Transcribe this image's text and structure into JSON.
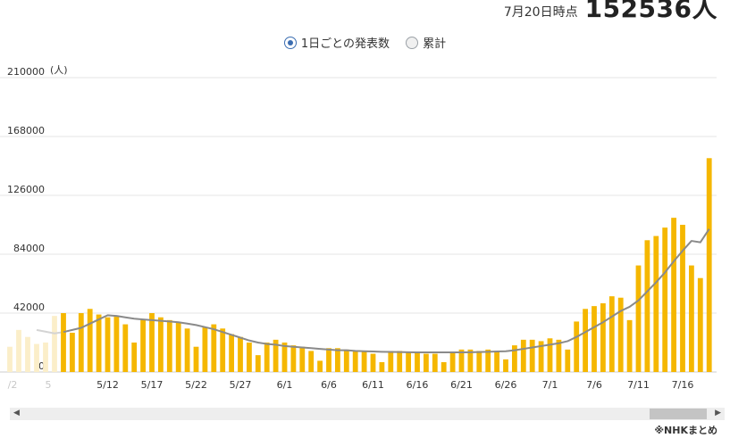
{
  "header": {
    "date_label": "7月20日時点",
    "total_value": "152536人"
  },
  "toggle": {
    "daily_label": "1日ごとの発表数",
    "cumulative_label": "累計",
    "selected": "daily"
  },
  "source": "※NHKまとめ",
  "colors": {
    "bar": "#f5b700",
    "faded_bar": "#fbeec9",
    "avg_line": "#8a8a8a",
    "faded_line": "#d4d4d4",
    "grid": "#e6e6e6"
  },
  "chart_data": {
    "type": "bar",
    "unit_label": "(人)",
    "ylim": [
      0,
      210000
    ],
    "y_ticks": [
      "0",
      "42000",
      "84000",
      "126000",
      "168000",
      "210000"
    ],
    "x_tick_labels": [
      "5/7",
      "5/12",
      "5/17",
      "5/22",
      "5/27",
      "6/1",
      "6/6",
      "6/11",
      "6/16",
      "6/21",
      "6/26",
      "7/1",
      "7/6",
      "7/11",
      "7/16"
    ],
    "start_date": "5/7",
    "faded_prefix": {
      "tick_labels": [
        "/2",
        "5"
      ],
      "values": [
        18000,
        30000,
        25000,
        20000,
        21000,
        40000
      ],
      "avg": [
        30000,
        27500
      ]
    },
    "series": [
      {
        "values": [
          42000,
          28000,
          42000,
          45000,
          41000,
          39000,
          40000,
          34000,
          21000,
          37000,
          42000,
          39000,
          37000,
          35000,
          31000,
          18000,
          32000,
          34000,
          31000,
          27000,
          25000,
          21000,
          12000,
          21000,
          23000,
          21000,
          19000,
          18000,
          15000,
          8000,
          17000,
          17000,
          16000,
          15000,
          15000,
          13000,
          7000,
          15000,
          15000,
          14000,
          14000,
          13000,
          13000,
          7000,
          14000,
          16000,
          16000,
          15000,
          16000,
          15000,
          9000,
          19000,
          23000,
          23000,
          22000,
          24000,
          23000,
          16000,
          36000,
          45000,
          47000,
          49000,
          54000,
          53000,
          37000,
          76000,
          94000,
          97000,
          103000,
          110000,
          105000,
          76000,
          67000,
          152536
        ]
      },
      {
        "values": [
          28500,
          30000,
          31500,
          34500,
          37500,
          40500,
          40000,
          39000,
          38000,
          37500,
          37000,
          36500,
          36000,
          35500,
          34500,
          33500,
          32000,
          30500,
          28500,
          26500,
          24500,
          22500,
          21000,
          20000,
          19500,
          18500,
          18000,
          17500,
          17000,
          16500,
          16000,
          15500,
          15500,
          15000,
          14800,
          14600,
          14400,
          14300,
          14200,
          14100,
          14000,
          14000,
          14000,
          14000,
          14000,
          14000,
          14100,
          14200,
          14400,
          14600,
          14800,
          15500,
          16500,
          17500,
          18500,
          19500,
          20500,
          22000,
          25000,
          28500,
          32000,
          35500,
          39500,
          43500,
          46500,
          51000,
          57500,
          64000,
          71000,
          79000,
          86500,
          93500,
          92500,
          102000
        ]
      }
    ]
  }
}
